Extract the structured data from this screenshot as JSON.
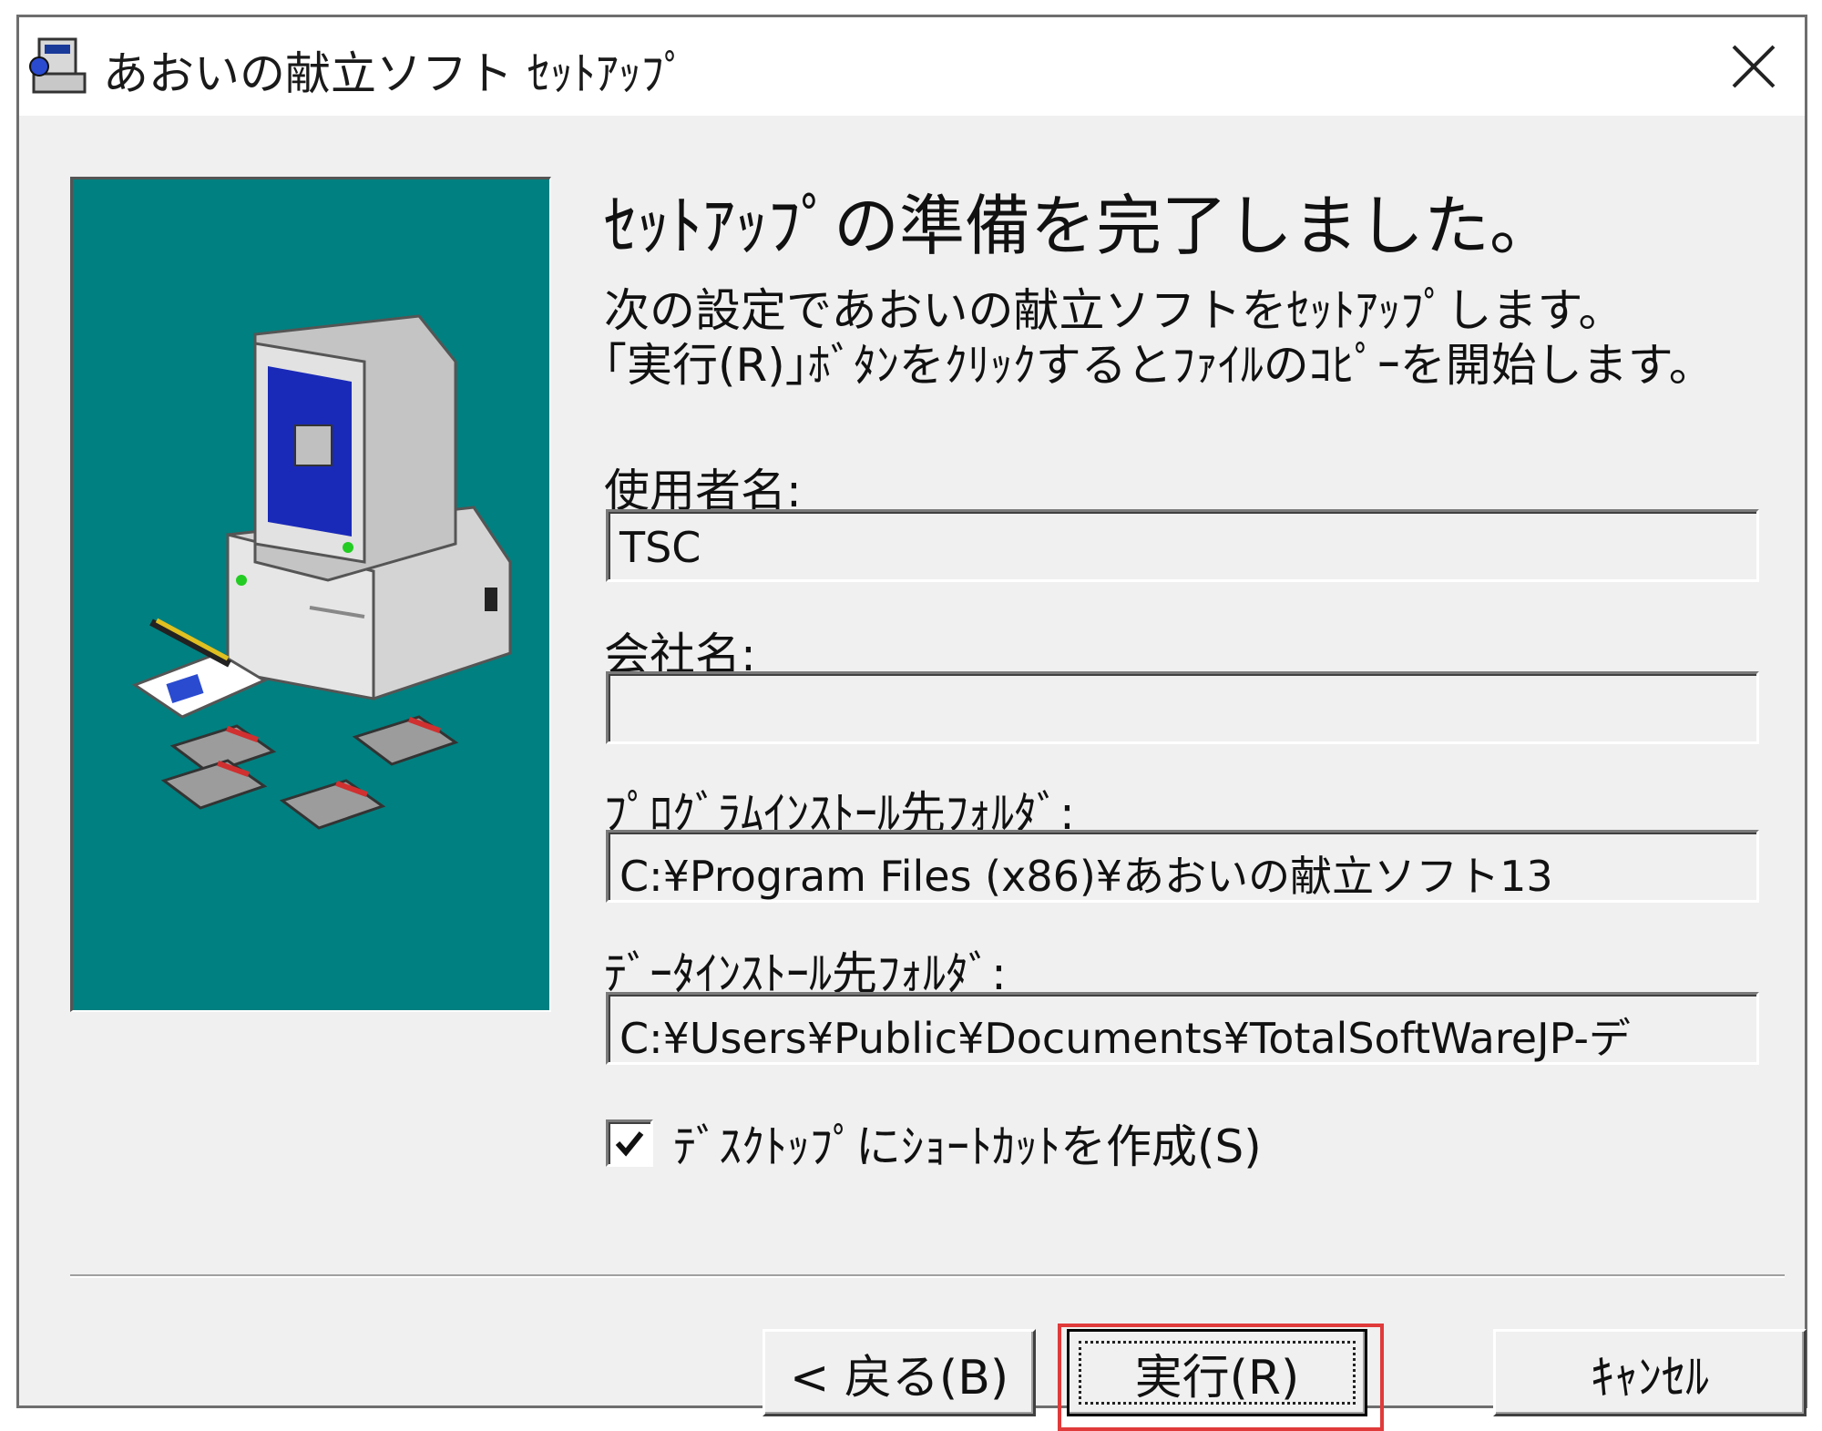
{
  "window": {
    "title": "あおいの献立ソフト ｾｯﾄｱｯﾌﾟ",
    "icon": "setup-program-icon",
    "close_icon": "close-icon"
  },
  "banner": {
    "color": "#008080",
    "illustration": "computer-with-floppy-disks"
  },
  "main": {
    "heading": "ｾｯﾄｱｯﾌﾟの準備を完了しました。",
    "description_line1": "次の設定であおいの献立ソフトをｾｯﾄｱｯﾌﾟします。",
    "description_line2": "｢実行(R)｣ﾎﾞﾀﾝをｸﾘｯｸするとﾌｧｲﾙのｺﾋﾟｰを開始します。"
  },
  "fields": {
    "user_name": {
      "label": "使用者名:",
      "value": "TSC"
    },
    "company_name": {
      "label": "会社名:",
      "value": ""
    },
    "program_folder": {
      "label": "ﾌﾟﾛｸﾞﾗﾑｲﾝｽﾄｰﾙ先ﾌｫﾙﾀﾞ:",
      "value": "C:¥Program Files (x86)¥あおいの献立ソフト13"
    },
    "data_folder": {
      "label": "ﾃﾞｰﾀｲﾝｽﾄｰﾙ先ﾌｫﾙﾀﾞ:",
      "value": "C:¥Users¥Public¥Documents¥TotalSoftWareJP-デ"
    }
  },
  "shortcut_checkbox": {
    "label": "ﾃﾞｽｸﾄｯﾌﾟにｼｮｰﾄｶｯﾄを作成(S)",
    "checked": true
  },
  "buttons": {
    "back": "< 戻る(B)",
    "run": "実行(R)",
    "cancel": "ｷｬﾝｾﾙ"
  },
  "colors": {
    "highlight": "#e03a3a",
    "dialog_bg": "#f0f0f0"
  }
}
